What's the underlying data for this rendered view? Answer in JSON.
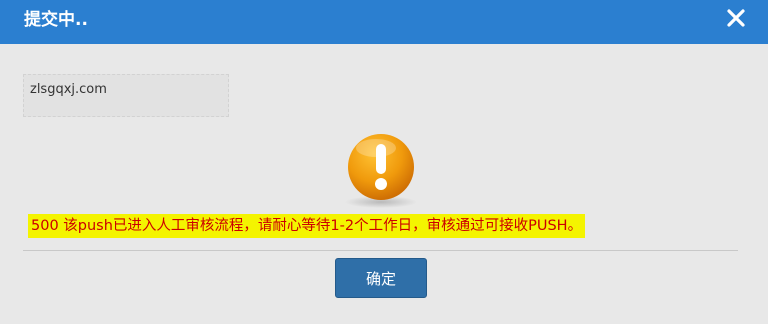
{
  "dialog": {
    "title": "提交中..",
    "domain": "zlsgqxj.com",
    "message": "500 该push已进入人工审核流程，请耐心等待1-2个工作日，审核通过可接收PUSH。",
    "confirm_label": "确定"
  },
  "icons": {
    "close": "close-icon",
    "warning": "warning-exclamation-icon"
  },
  "colors": {
    "titlebar": "#2b7fd0",
    "message_bg": "#f4f400",
    "message_text": "#cc0000",
    "button": "#2f6fa8",
    "warning": "#e8900a"
  }
}
